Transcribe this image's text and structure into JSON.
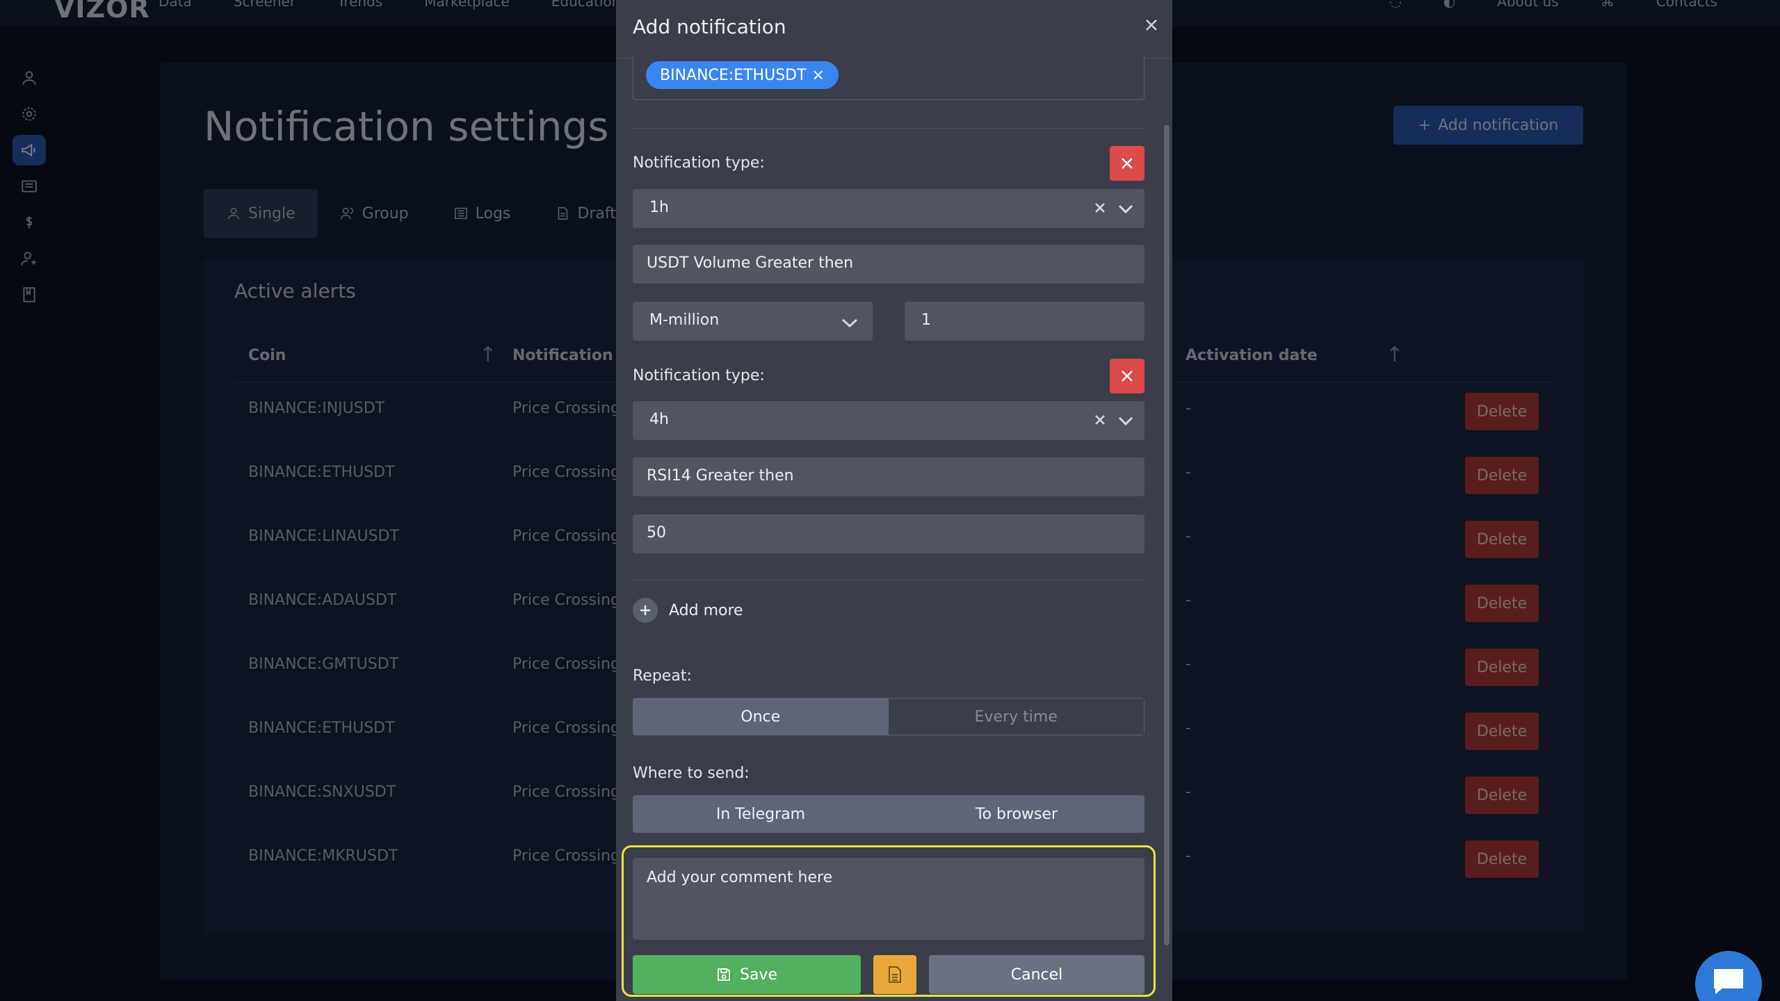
{
  "app": {
    "logo": "VIZOR",
    "top_nav": [
      "Data",
      "Screener",
      "Trends",
      "Marketplace",
      "Education"
    ],
    "top_right": [
      "About us",
      "Contacts"
    ]
  },
  "page": {
    "title": "Notification settings",
    "add_button": "Add notification",
    "tabs": [
      {
        "label": "Single",
        "icon": "user-icon"
      },
      {
        "label": "Group",
        "icon": "users-icon"
      },
      {
        "label": "Logs",
        "icon": "list-icon"
      },
      {
        "label": "Drafts",
        "icon": "document-icon"
      }
    ],
    "alerts": {
      "title": "Active alerts",
      "columns": {
        "coin": "Coin",
        "notification_type": "Notification ty",
        "activation_date": "Activation date"
      },
      "rows": [
        {
          "coin": "BINANCE:INJUSDT",
          "type": "Price Crossing",
          "date": "-",
          "action": "Delete"
        },
        {
          "coin": "BINANCE:ETHUSDT",
          "type": "Price Crossing",
          "date": "-",
          "action": "Delete"
        },
        {
          "coin": "BINANCE:LINAUSDT",
          "type": "Price Crossing",
          "date": "-",
          "action": "Delete"
        },
        {
          "coin": "BINANCE:ADAUSDT",
          "type": "Price Crossing",
          "date": "-",
          "action": "Delete"
        },
        {
          "coin": "BINANCE:GMTUSDT",
          "type": "Price Crossing",
          "date": "-",
          "action": "Delete"
        },
        {
          "coin": "BINANCE:ETHUSDT",
          "type": "Price Crossing",
          "date": "-",
          "action": "Delete"
        },
        {
          "coin": "BINANCE:SNXUSDT",
          "type": "Price Crossing",
          "date": "-",
          "action": "Delete"
        },
        {
          "coin": "BINANCE:MKRUSDT",
          "type": "Price Crossing",
          "date": "-",
          "action": "Delete"
        }
      ]
    }
  },
  "modal": {
    "title": "Add notification",
    "coin_chip": "BINANCE:ETHUSDT",
    "notifications": [
      {
        "label": "Notification type:",
        "timeframe": "1h",
        "condition": "USDT Volume Greater then",
        "unit": "M-million",
        "value": "1"
      },
      {
        "label": "Notification type:",
        "timeframe": "4h",
        "condition": "RSI14 Greater then",
        "value": "50"
      }
    ],
    "add_more": "Add more",
    "repeat": {
      "label": "Repeat:",
      "options": [
        "Once",
        "Every time"
      ],
      "selected": "Once"
    },
    "send": {
      "label": "Where to send:",
      "options": [
        "In Telegram",
        "To browser"
      ]
    },
    "comment_placeholder": "Add your comment here",
    "save": "Save",
    "cancel": "Cancel"
  },
  "colors": {
    "accent": "#2a5bb0",
    "chip": "#3a86f0",
    "danger": "#dc4a4a",
    "save": "#52b05e",
    "draft": "#e8a93a",
    "highlight": "#e8e245"
  }
}
